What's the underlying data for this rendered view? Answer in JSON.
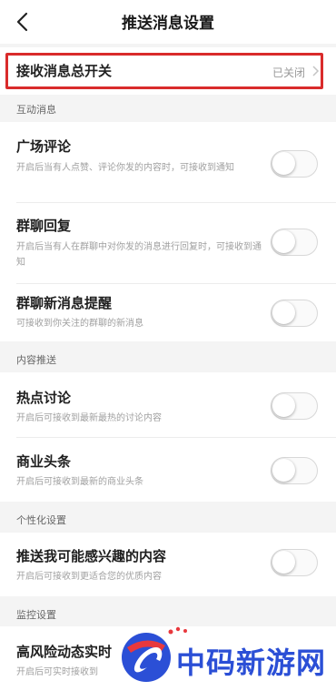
{
  "nav": {
    "title": "推送消息设置",
    "back_icon": "back-arrow-icon"
  },
  "master_switch": {
    "label": "接收消息总开关",
    "status": "已关闭",
    "highlight_color": "#d92b2b"
  },
  "sections": [
    {
      "header": "互动消息",
      "items": [
        {
          "title": "广场评论",
          "desc": "开启后当有人点赞、评论你发的内容时，可接收到通知",
          "enabled": false
        },
        {
          "title": "群聊回复",
          "desc": "开启后当有人在群聊中对你发的消息进行回复时，可接收到通知",
          "enabled": false
        },
        {
          "title": "群聊新消息提醒",
          "desc": "可接收到你关注的群聊的新消息",
          "enabled": false
        }
      ]
    },
    {
      "header": "内容推送",
      "items": [
        {
          "title": "热点讨论",
          "desc": "开启后可接收到最新最热的讨论内容",
          "enabled": false
        },
        {
          "title": "商业头条",
          "desc": "开启后可接收到最新的商业头条",
          "enabled": false
        }
      ]
    },
    {
      "header": "个性化设置",
      "items": [
        {
          "title": "推送我可能感兴趣的内容",
          "desc": "开启后可接收到更适合您的优质内容",
          "enabled": false
        }
      ]
    },
    {
      "header": "监控设置",
      "items": [
        {
          "title": "高风险动态实时",
          "desc": "开启后可实时接收到"
        }
      ]
    }
  ],
  "watermark": {
    "text": "中码新游网",
    "color": "#2b4fd6"
  }
}
